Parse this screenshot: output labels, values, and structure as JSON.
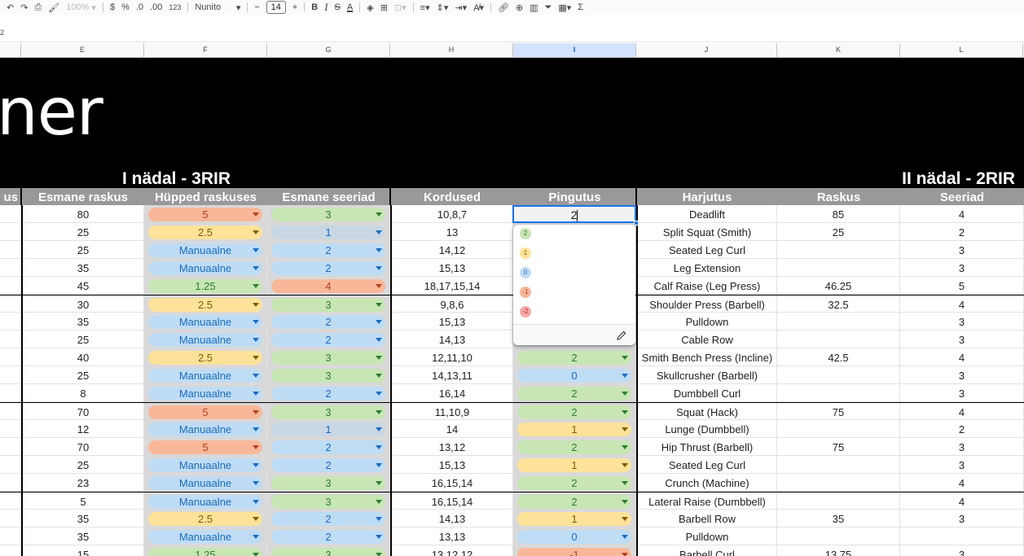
{
  "toolbar": {
    "zoom": "100%",
    "currency": "$",
    "percent": "%",
    "dec_decrease": ".0",
    "dec_increase": ".00",
    "number_format": "123",
    "font": "Nunito",
    "font_size_minus": "−",
    "font_size": "14",
    "font_size_plus": "+",
    "bold": "B",
    "italic": "I",
    "text_color": "A",
    "sum": "Σ"
  },
  "formula_bar": {
    "value": "2"
  },
  "columns": [
    {
      "letter": "E"
    },
    {
      "letter": "F"
    },
    {
      "letter": "G"
    },
    {
      "letter": "H"
    },
    {
      "letter": "I"
    },
    {
      "letter": "J"
    },
    {
      "letter": "K"
    },
    {
      "letter": "L"
    }
  ],
  "banner": {
    "title": "ner",
    "week1": "I nädal - 3RIR",
    "week2": "II nädal - 2RIR"
  },
  "headers": {
    "d": "us",
    "e": "Esmane raskus",
    "f": "Hüpped raskuses",
    "g": "Esmane seeriad",
    "h": "Kordused",
    "i": "Pingutus",
    "j": "Harjutus",
    "k": "Raskus",
    "l": "Seeriad"
  },
  "active_cell": {
    "value": "2"
  },
  "dropdown": {
    "options": [
      {
        "label": "2",
        "color": "#c8e6b4",
        "text": "#2e7d32"
      },
      {
        "label": "1",
        "color": "#ffe29a",
        "text": "#7e5d00"
      },
      {
        "label": "0",
        "color": "#bfdcf5",
        "text": "#1a6cc0"
      },
      {
        "label": "-1",
        "color": "#f9b79a",
        "text": "#b5401a"
      },
      {
        "label": "-2",
        "color": "#f7a8a8",
        "text": "#c62828"
      }
    ]
  },
  "colors": {
    "orange": "#f9b79a",
    "yellow": "#ffe29a",
    "green": "#c8e6b4",
    "blue": "#bfdcf5",
    "selection": "#1a73e8",
    "header_bg": "#999999"
  },
  "rows": [
    {
      "e": "80",
      "f": "5",
      "fc": "o",
      "g": "3",
      "gc": "g",
      "h": "10,8,7",
      "i": "",
      "ic": "",
      "j": "Deadlift",
      "k": "85",
      "l": "4",
      "thick": false
    },
    {
      "e": "25",
      "f": "2.5",
      "fc": "y",
      "g": "1",
      "gc": "grey",
      "h": "13",
      "i": "",
      "ic": "",
      "j": "Split Squat (Smith)",
      "k": "25",
      "l": "2",
      "thick": false
    },
    {
      "e": "25",
      "f": "Manuaalne",
      "fc": "b",
      "g": "2",
      "gc": "b",
      "h": "14,12",
      "i": "",
      "ic": "",
      "j": "Seated Leg Curl",
      "k": "",
      "l": "3",
      "thick": false
    },
    {
      "e": "35",
      "f": "Manuaalne",
      "fc": "b",
      "g": "2",
      "gc": "b",
      "h": "15,13",
      "i": "",
      "ic": "",
      "j": "Leg Extension",
      "k": "",
      "l": "3",
      "thick": false
    },
    {
      "e": "45",
      "f": "1.25",
      "fc": "g",
      "g": "4",
      "gc": "o",
      "h": "18,17,15,14",
      "i": "",
      "ic": "",
      "j": "Calf Raise (Leg Press)",
      "k": "46.25",
      "l": "5",
      "thick": false
    },
    {
      "e": "30",
      "f": "2.5",
      "fc": "y",
      "g": "3",
      "gc": "g",
      "h": "9,8,6",
      "i": "",
      "ic": "",
      "j": "Shoulder Press (Barbell)",
      "k": "32.5",
      "l": "4",
      "thick": true
    },
    {
      "e": "35",
      "f": "Manuaalne",
      "fc": "b",
      "g": "2",
      "gc": "b",
      "h": "15,13",
      "i": "",
      "ic": "",
      "j": "Pulldown",
      "k": "",
      "l": "3",
      "thick": false
    },
    {
      "e": "25",
      "f": "Manuaalne",
      "fc": "b",
      "g": "2",
      "gc": "b",
      "h": "14,13",
      "i": "",
      "ic": "",
      "j": "Cable Row",
      "k": "",
      "l": "3",
      "thick": false
    },
    {
      "e": "40",
      "f": "2.5",
      "fc": "y",
      "g": "3",
      "gc": "g",
      "h": "12,11,10",
      "i": "2",
      "ic": "g",
      "j": "Smith Bench Press (Incline)",
      "k": "42.5",
      "l": "4",
      "thick": false
    },
    {
      "e": "25",
      "f": "Manuaalne",
      "fc": "b",
      "g": "3",
      "gc": "g",
      "h": "14,13,11",
      "i": "0",
      "ic": "b",
      "j": "Skullcrusher (Barbell)",
      "k": "",
      "l": "3",
      "thick": false
    },
    {
      "e": "8",
      "f": "Manuaalne",
      "fc": "b",
      "g": "2",
      "gc": "b",
      "h": "16,14",
      "i": "2",
      "ic": "g",
      "j": "Dumbbell Curl",
      "k": "",
      "l": "3",
      "thick": false
    },
    {
      "e": "70",
      "f": "5",
      "fc": "o",
      "g": "3",
      "gc": "g",
      "h": "11,10,9",
      "i": "2",
      "ic": "g",
      "j": "Squat (Hack)",
      "k": "75",
      "l": "4",
      "thick": true
    },
    {
      "e": "12",
      "f": "Manuaalne",
      "fc": "b",
      "g": "1",
      "gc": "grey",
      "h": "14",
      "i": "1",
      "ic": "y",
      "j": "Lunge (Dumbbell)",
      "k": "",
      "l": "2",
      "thick": false
    },
    {
      "e": "70",
      "f": "5",
      "fc": "o",
      "g": "2",
      "gc": "b",
      "h": "13,12",
      "i": "2",
      "ic": "g",
      "j": "Hip Thrust (Barbell)",
      "k": "75",
      "l": "3",
      "thick": false
    },
    {
      "e": "25",
      "f": "Manuaalne",
      "fc": "b",
      "g": "2",
      "gc": "b",
      "h": "15,13",
      "i": "1",
      "ic": "y",
      "j": "Seated Leg Curl",
      "k": "",
      "l": "3",
      "thick": false
    },
    {
      "e": "23",
      "f": "Manuaalne",
      "fc": "b",
      "g": "3",
      "gc": "g",
      "h": "16,15,14",
      "i": "2",
      "ic": "g",
      "j": "Crunch (Machine)",
      "k": "",
      "l": "4",
      "thick": false
    },
    {
      "e": "5",
      "f": "Manuaalne",
      "fc": "b",
      "g": "3",
      "gc": "g",
      "h": "16,15,14",
      "i": "2",
      "ic": "g",
      "j": "Lateral Raise (Dumbbell)",
      "k": "",
      "l": "4",
      "thick": true
    },
    {
      "e": "35",
      "f": "2.5",
      "fc": "y",
      "g": "2",
      "gc": "b",
      "h": "14,13",
      "i": "1",
      "ic": "y",
      "j": "Barbell Row",
      "k": "35",
      "l": "3",
      "thick": false
    },
    {
      "e": "35",
      "f": "Manuaalne",
      "fc": "b",
      "g": "2",
      "gc": "b",
      "h": "13,13",
      "i": "0",
      "ic": "b",
      "j": "Pulldown",
      "k": "",
      "l": "",
      "thick": false
    },
    {
      "e": "15",
      "f": "1.25",
      "fc": "g",
      "g": "3",
      "gc": "g",
      "h": "13,12,12",
      "i": "-1",
      "ic": "o",
      "j": "Barbell Curl",
      "k": "13.75",
      "l": "3",
      "thick": false
    }
  ]
}
